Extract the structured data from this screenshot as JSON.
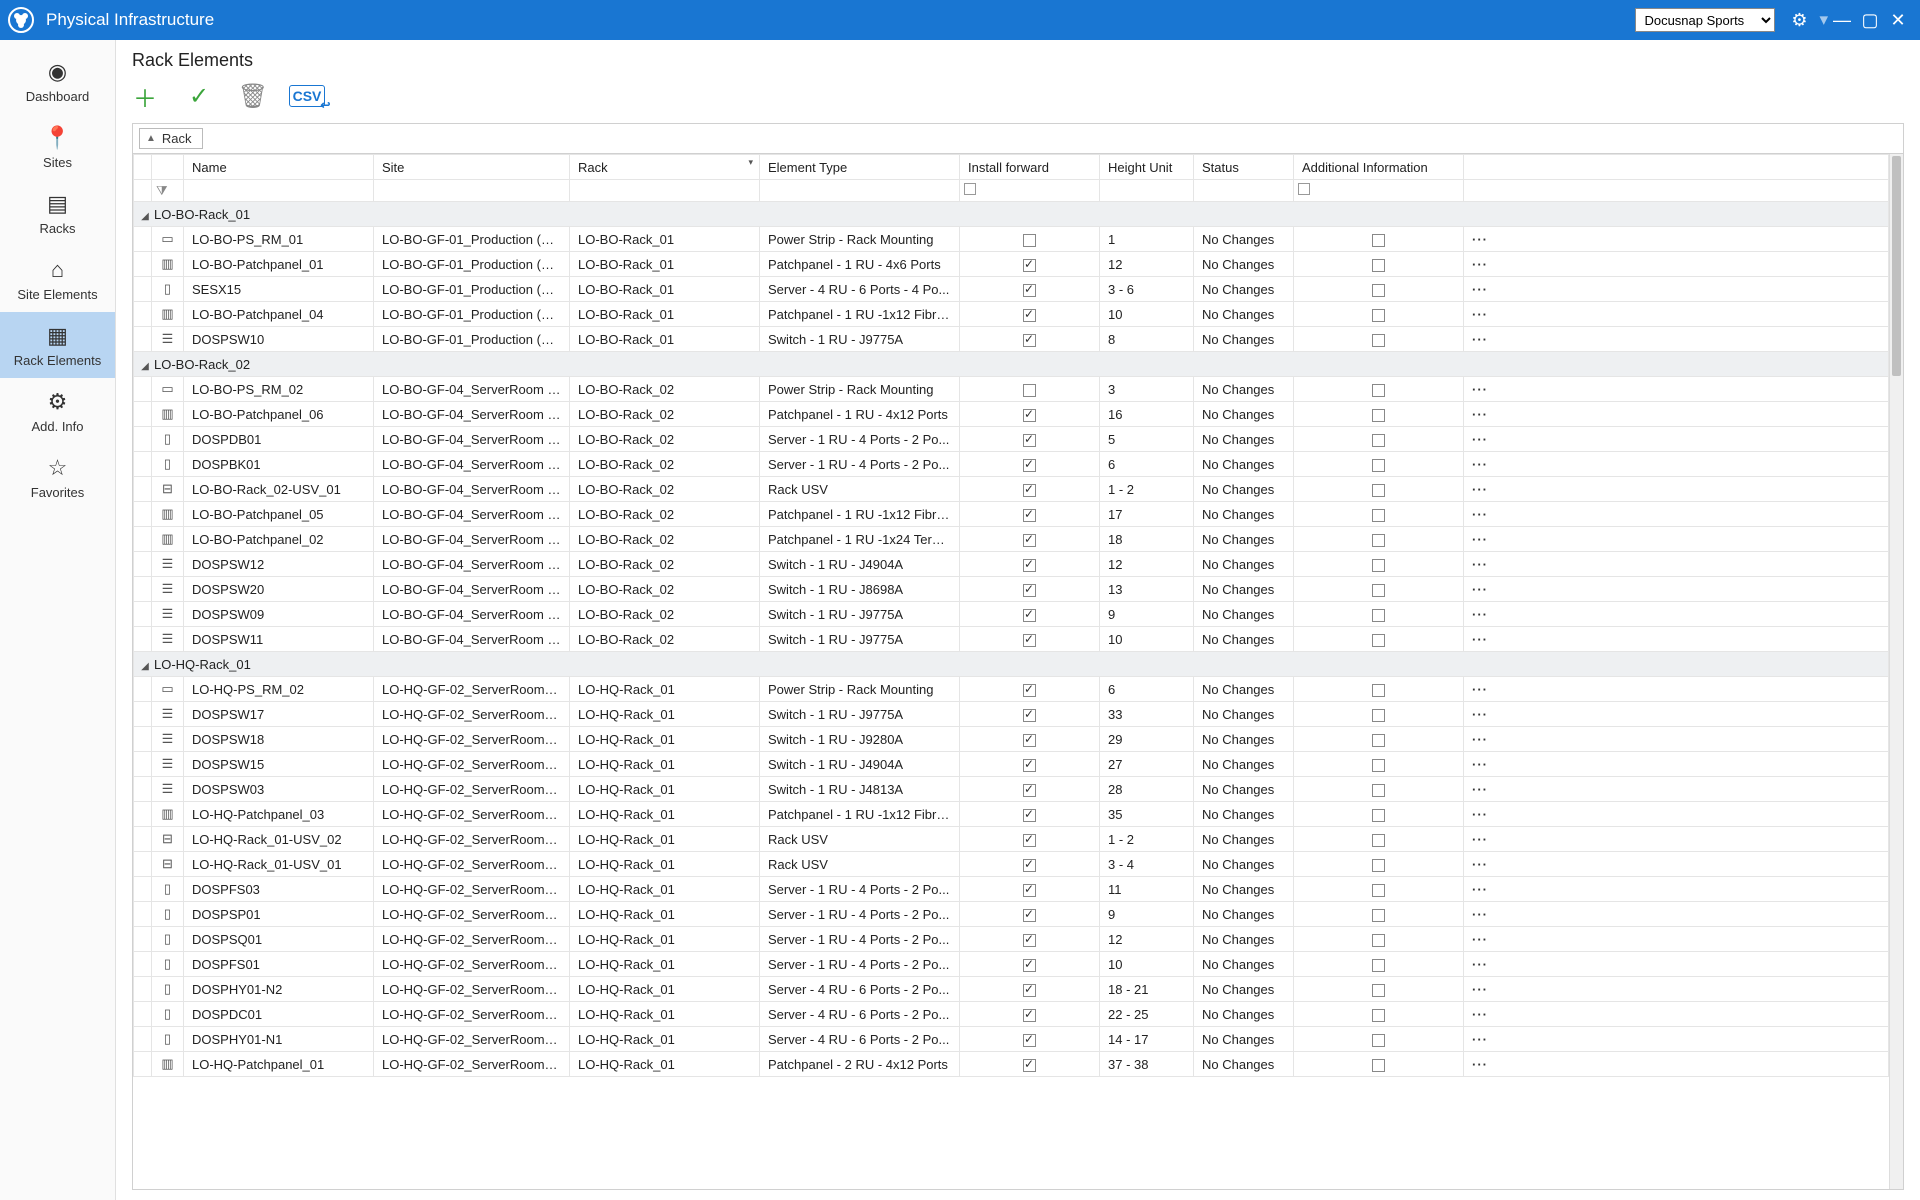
{
  "titlebar": {
    "title": "Physical Infrastructure",
    "tenant": "Docusnap Sports"
  },
  "sidebar": {
    "items": [
      {
        "label": "Dashboard",
        "icon": "◉"
      },
      {
        "label": "Sites",
        "icon": "📍"
      },
      {
        "label": "Racks",
        "icon": "▤"
      },
      {
        "label": "Site Elements",
        "icon": "⌂"
      },
      {
        "label": "Rack Elements",
        "icon": "▦",
        "selected": true
      },
      {
        "label": "Add. Info",
        "icon": "⚙"
      },
      {
        "label": "Favorites",
        "icon": "☆"
      }
    ]
  },
  "page": {
    "title": "Rack Elements",
    "group_chip": "Rack"
  },
  "columns": [
    "Name",
    "Site",
    "Rack",
    "Element Type",
    "Install forward",
    "Height Unit",
    "Status",
    "Additional Information",
    ""
  ],
  "groups": [
    {
      "name": "LO-BO-Rack_01",
      "rows": [
        {
          "icon": "▭",
          "name": "LO-BO-PS_RM_01",
          "site": "LO-BO-GF-01_Production (Lo...",
          "rack": "LO-BO-Rack_01",
          "elem": "Power Strip - Rack Mounting",
          "fwd": false,
          "hu": "1",
          "stat": "No Changes",
          "add": false
        },
        {
          "icon": "▥",
          "name": "LO-BO-Patchpanel_01",
          "site": "LO-BO-GF-01_Production (Lo...",
          "rack": "LO-BO-Rack_01",
          "elem": "Patchpanel - 1 RU - 4x6 Ports",
          "fwd": true,
          "hu": "12",
          "stat": "No Changes",
          "add": false
        },
        {
          "icon": "▯",
          "name": "SESX15",
          "site": "LO-BO-GF-01_Production (Lo...",
          "rack": "LO-BO-Rack_01",
          "elem": "Server - 4 RU - 6 Ports - 4 Po...",
          "fwd": true,
          "hu": "3 - 6",
          "stat": "No Changes",
          "add": false
        },
        {
          "icon": "▥",
          "name": "LO-BO-Patchpanel_04",
          "site": "LO-BO-GF-01_Production (Lo...",
          "rack": "LO-BO-Rack_01",
          "elem": "Patchpanel - 1 RU -1x12 Fibre...",
          "fwd": true,
          "hu": "10",
          "stat": "No Changes",
          "add": false
        },
        {
          "icon": "☰",
          "name": "DOSPSW10",
          "site": "LO-BO-GF-01_Production (Lo...",
          "rack": "LO-BO-Rack_01",
          "elem": "Switch - 1 RU - J9775A",
          "fwd": true,
          "hu": "8",
          "stat": "No Changes",
          "add": false
        }
      ]
    },
    {
      "name": "LO-BO-Rack_02",
      "rows": [
        {
          "icon": "▭",
          "name": "LO-BO-PS_RM_02",
          "site": "LO-BO-GF-04_ServerRoom (L...",
          "rack": "LO-BO-Rack_02",
          "elem": "Power Strip - Rack Mounting",
          "fwd": false,
          "hu": "3",
          "stat": "No Changes",
          "add": false
        },
        {
          "icon": "▥",
          "name": "LO-BO-Patchpanel_06",
          "site": "LO-BO-GF-04_ServerRoom (L...",
          "rack": "LO-BO-Rack_02",
          "elem": "Patchpanel - 1 RU - 4x12 Ports",
          "fwd": true,
          "hu": "16",
          "stat": "No Changes",
          "add": false
        },
        {
          "icon": "▯",
          "name": "DOSPDB01",
          "site": "LO-BO-GF-04_ServerRoom (L...",
          "rack": "LO-BO-Rack_02",
          "elem": "Server - 1 RU - 4 Ports - 2 Po...",
          "fwd": true,
          "hu": "5",
          "stat": "No Changes",
          "add": false
        },
        {
          "icon": "▯",
          "name": "DOSPBK01",
          "site": "LO-BO-GF-04_ServerRoom (L...",
          "rack": "LO-BO-Rack_02",
          "elem": "Server - 1 RU - 4 Ports - 2 Po...",
          "fwd": true,
          "hu": "6",
          "stat": "No Changes",
          "add": false
        },
        {
          "icon": "⊟",
          "name": "LO-BO-Rack_02-USV_01",
          "site": "LO-BO-GF-04_ServerRoom (L...",
          "rack": "LO-BO-Rack_02",
          "elem": "Rack USV",
          "fwd": true,
          "hu": "1 - 2",
          "stat": "No Changes",
          "add": false
        },
        {
          "icon": "▥",
          "name": "LO-BO-Patchpanel_05",
          "site": "LO-BO-GF-04_ServerRoom (L...",
          "rack": "LO-BO-Rack_02",
          "elem": "Patchpanel - 1 RU -1x12 Fibre...",
          "fwd": true,
          "hu": "17",
          "stat": "No Changes",
          "add": false
        },
        {
          "icon": "▥",
          "name": "LO-BO-Patchpanel_02",
          "site": "LO-BO-GF-04_ServerRoom (L...",
          "rack": "LO-BO-Rack_02",
          "elem": "Patchpanel - 1 RU -1x24 Tera-...",
          "fwd": true,
          "hu": "18",
          "stat": "No Changes",
          "add": false
        },
        {
          "icon": "☰",
          "name": "DOSPSW12",
          "site": "LO-BO-GF-04_ServerRoom (L...",
          "rack": "LO-BO-Rack_02",
          "elem": "Switch - 1 RU - J4904A",
          "fwd": true,
          "hu": "12",
          "stat": "No Changes",
          "add": false
        },
        {
          "icon": "☰",
          "name": "DOSPSW20",
          "site": "LO-BO-GF-04_ServerRoom (L...",
          "rack": "LO-BO-Rack_02",
          "elem": "Switch - 1 RU - J8698A",
          "fwd": true,
          "hu": "13",
          "stat": "No Changes",
          "add": false
        },
        {
          "icon": "☰",
          "name": "DOSPSW09",
          "site": "LO-BO-GF-04_ServerRoom (L...",
          "rack": "LO-BO-Rack_02",
          "elem": "Switch - 1 RU - J9775A",
          "fwd": true,
          "hu": "9",
          "stat": "No Changes",
          "add": false
        },
        {
          "icon": "☰",
          "name": "DOSPSW11",
          "site": "LO-BO-GF-04_ServerRoom (L...",
          "rack": "LO-BO-Rack_02",
          "elem": "Switch - 1 RU - J9775A",
          "fwd": true,
          "hu": "10",
          "stat": "No Changes",
          "add": false
        }
      ]
    },
    {
      "name": "LO-HQ-Rack_01",
      "rows": [
        {
          "icon": "▭",
          "name": "LO-HQ-PS_RM_02",
          "site": "LO-HQ-GF-02_ServerRoom (L...",
          "rack": "LO-HQ-Rack_01",
          "elem": "Power Strip - Rack Mounting",
          "fwd": true,
          "hu": "6",
          "stat": "No Changes",
          "add": false
        },
        {
          "icon": "☰",
          "name": "DOSPSW17",
          "site": "LO-HQ-GF-02_ServerRoom (L...",
          "rack": "LO-HQ-Rack_01",
          "elem": "Switch - 1 RU - J9775A",
          "fwd": true,
          "hu": "33",
          "stat": "No Changes",
          "add": false
        },
        {
          "icon": "☰",
          "name": "DOSPSW18",
          "site": "LO-HQ-GF-02_ServerRoom (L...",
          "rack": "LO-HQ-Rack_01",
          "elem": "Switch - 1 RU - J9280A",
          "fwd": true,
          "hu": "29",
          "stat": "No Changes",
          "add": false
        },
        {
          "icon": "☰",
          "name": "DOSPSW15",
          "site": "LO-HQ-GF-02_ServerRoom (L...",
          "rack": "LO-HQ-Rack_01",
          "elem": "Switch - 1 RU - J4904A",
          "fwd": true,
          "hu": "27",
          "stat": "No Changes",
          "add": false
        },
        {
          "icon": "☰",
          "name": "DOSPSW03",
          "site": "LO-HQ-GF-02_ServerRoom (L...",
          "rack": "LO-HQ-Rack_01",
          "elem": "Switch - 1 RU - J4813A",
          "fwd": true,
          "hu": "28",
          "stat": "No Changes",
          "add": false
        },
        {
          "icon": "▥",
          "name": "LO-HQ-Patchpanel_03",
          "site": "LO-HQ-GF-02_ServerRoom (L...",
          "rack": "LO-HQ-Rack_01",
          "elem": "Patchpanel - 1 RU -1x12 Fibre...",
          "fwd": true,
          "hu": "35",
          "stat": "No Changes",
          "add": false
        },
        {
          "icon": "⊟",
          "name": "LO-HQ-Rack_01-USV_02",
          "site": "LO-HQ-GF-02_ServerRoom (L...",
          "rack": "LO-HQ-Rack_01",
          "elem": "Rack USV",
          "fwd": true,
          "hu": "1 - 2",
          "stat": "No Changes",
          "add": false
        },
        {
          "icon": "⊟",
          "name": "LO-HQ-Rack_01-USV_01",
          "site": "LO-HQ-GF-02_ServerRoom (L...",
          "rack": "LO-HQ-Rack_01",
          "elem": "Rack USV",
          "fwd": true,
          "hu": "3 - 4",
          "stat": "No Changes",
          "add": false
        },
        {
          "icon": "▯",
          "name": "DOSPFS03",
          "site": "LO-HQ-GF-02_ServerRoom (L...",
          "rack": "LO-HQ-Rack_01",
          "elem": "Server - 1 RU - 4 Ports - 2 Po...",
          "fwd": true,
          "hu": "11",
          "stat": "No Changes",
          "add": false
        },
        {
          "icon": "▯",
          "name": "DOSPSP01",
          "site": "LO-HQ-GF-02_ServerRoom (L...",
          "rack": "LO-HQ-Rack_01",
          "elem": "Server - 1 RU - 4 Ports - 2 Po...",
          "fwd": true,
          "hu": "9",
          "stat": "No Changes",
          "add": false
        },
        {
          "icon": "▯",
          "name": "DOSPSQ01",
          "site": "LO-HQ-GF-02_ServerRoom (L...",
          "rack": "LO-HQ-Rack_01",
          "elem": "Server - 1 RU - 4 Ports - 2 Po...",
          "fwd": true,
          "hu": "12",
          "stat": "No Changes",
          "add": false
        },
        {
          "icon": "▯",
          "name": "DOSPFS01",
          "site": "LO-HQ-GF-02_ServerRoom (L...",
          "rack": "LO-HQ-Rack_01",
          "elem": "Server - 1 RU - 4 Ports - 2 Po...",
          "fwd": true,
          "hu": "10",
          "stat": "No Changes",
          "add": false
        },
        {
          "icon": "▯",
          "name": "DOSPHY01-N2",
          "site": "LO-HQ-GF-02_ServerRoom (L...",
          "rack": "LO-HQ-Rack_01",
          "elem": "Server - 4 RU - 6 Ports - 2 Po...",
          "fwd": true,
          "hu": "18 - 21",
          "stat": "No Changes",
          "add": false
        },
        {
          "icon": "▯",
          "name": "DOSPDC01",
          "site": "LO-HQ-GF-02_ServerRoom (L...",
          "rack": "LO-HQ-Rack_01",
          "elem": "Server - 4 RU - 6 Ports - 2 Po...",
          "fwd": true,
          "hu": "22 - 25",
          "stat": "No Changes",
          "add": false
        },
        {
          "icon": "▯",
          "name": "DOSPHY01-N1",
          "site": "LO-HQ-GF-02_ServerRoom (L...",
          "rack": "LO-HQ-Rack_01",
          "elem": "Server - 4 RU - 6 Ports - 2 Po...",
          "fwd": true,
          "hu": "14 - 17",
          "stat": "No Changes",
          "add": false
        },
        {
          "icon": "▥",
          "name": "LO-HQ-Patchpanel_01",
          "site": "LO-HQ-GF-02_ServerRoom (L...",
          "rack": "LO-HQ-Rack_01",
          "elem": "Patchpanel - 2 RU - 4x12 Ports",
          "fwd": true,
          "hu": "37 - 38",
          "stat": "No Changes",
          "add": false
        }
      ]
    }
  ]
}
